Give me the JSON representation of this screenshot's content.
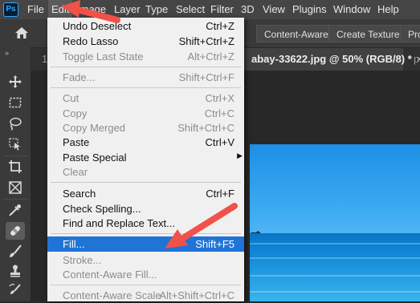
{
  "app": {
    "logo": "Ps"
  },
  "menubar": {
    "items": [
      "File",
      "Edit",
      "Image",
      "Layer",
      "Type",
      "Select",
      "Filter",
      "3D",
      "View",
      "Plugins",
      "Window",
      "Help"
    ]
  },
  "optionsbar": {
    "buttons": [
      "Content-Aware",
      "Create Texture",
      "Prox"
    ]
  },
  "toolbar": {
    "collapse_glyph": "»"
  },
  "tabs": {
    "left_fragment": "1",
    "active_label": "abay-33622.jpg @ 50% (RGB/8) *",
    "close_glyph": "×",
    "right_fragment": "p"
  },
  "edit_menu": {
    "items": [
      {
        "label": "Undo Deselect",
        "shortcut": "Ctrl+Z",
        "disabled": false
      },
      {
        "label": "Redo Lasso",
        "shortcut": "Shift+Ctrl+Z",
        "disabled": false
      },
      {
        "label": "Toggle Last State",
        "shortcut": "Alt+Ctrl+Z",
        "disabled": true
      },
      {
        "label": "Fade...",
        "shortcut": "Shift+Ctrl+F",
        "disabled": true
      },
      {
        "label": "Cut",
        "shortcut": "Ctrl+X",
        "disabled": true
      },
      {
        "label": "Copy",
        "shortcut": "Ctrl+C",
        "disabled": true
      },
      {
        "label": "Copy Merged",
        "shortcut": "Shift+Ctrl+C",
        "disabled": true
      },
      {
        "label": "Paste",
        "shortcut": "Ctrl+V",
        "disabled": false
      },
      {
        "label": "Paste Special",
        "shortcut": "",
        "disabled": false
      },
      {
        "label": "Clear",
        "shortcut": "",
        "disabled": true
      },
      {
        "label": "Search",
        "shortcut": "Ctrl+F",
        "disabled": false
      },
      {
        "label": "Check Spelling...",
        "shortcut": "",
        "disabled": false
      },
      {
        "label": "Find and Replace Text...",
        "shortcut": "",
        "disabled": false
      },
      {
        "label": "Fill...",
        "shortcut": "Shift+F5",
        "disabled": false,
        "highlighted": true
      },
      {
        "label": "Stroke...",
        "shortcut": "",
        "disabled": true
      },
      {
        "label": "Content-Aware Fill...",
        "shortcut": "",
        "disabled": true
      },
      {
        "label": "Content-Aware Scale",
        "shortcut": "Alt+Shift+Ctrl+C",
        "disabled": true
      }
    ]
  },
  "colors": {
    "menu_highlight": "#1f74d6",
    "annotation_arrow": "#f0524a"
  }
}
